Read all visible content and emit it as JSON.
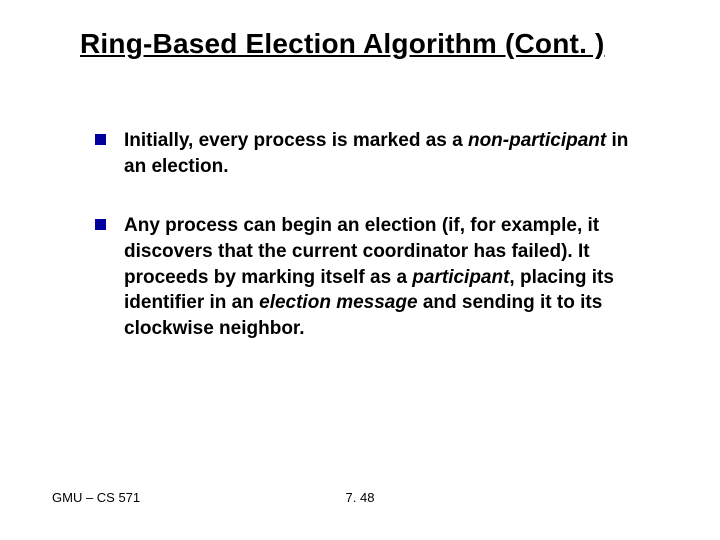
{
  "title": "Ring-Based Election Algorithm (Cont. )",
  "bullets": [
    {
      "pre": "Initially, every process is marked as a ",
      "em": "non-participant",
      "post": "  in an election."
    },
    {
      "pre": "Any process can begin an election (if, for example, it discovers that the current coordinator has failed). It proceeds by marking itself as a ",
      "em": "participant",
      "mid": ", placing its identifier in an ",
      "em2": "election message",
      "post": "  and sending it to its clockwise neighbor."
    }
  ],
  "footer": {
    "left": "GMU – CS 571",
    "center": "7. 48"
  }
}
